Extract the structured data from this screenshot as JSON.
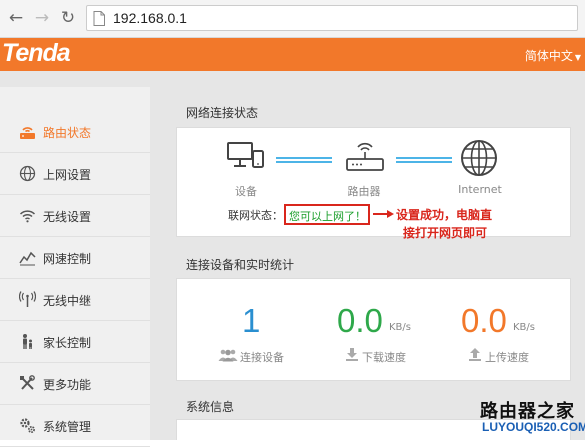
{
  "browser": {
    "url": "192.168.0.1"
  },
  "header": {
    "logo": "Tenda",
    "language": "简体中文",
    "brand_color": "#f2782a"
  },
  "sidebar": {
    "items": [
      {
        "label": "路由状态",
        "icon": "router-icon",
        "active": true
      },
      {
        "label": "上网设置",
        "icon": "globe-icon",
        "active": false
      },
      {
        "label": "无线设置",
        "icon": "wifi-icon",
        "active": false
      },
      {
        "label": "网速控制",
        "icon": "speed-chart-icon",
        "active": false
      },
      {
        "label": "无线中继",
        "icon": "antenna-icon",
        "active": false
      },
      {
        "label": "家长控制",
        "icon": "parent-child-icon",
        "active": false
      },
      {
        "label": "更多功能",
        "icon": "tools-icon",
        "active": false
      },
      {
        "label": "系统管理",
        "icon": "gears-icon",
        "active": false
      }
    ]
  },
  "network_status": {
    "title": "网络连接状态",
    "device_label": "设备",
    "router_label": "路由器",
    "internet_label": "Internet",
    "status_prefix": "联网状态：",
    "status_text": "您可以上网了！",
    "status_color": "#1a9e2a"
  },
  "annotation": {
    "line1": "设置成功，电脑直",
    "line2": "接打开网页即可",
    "color": "#d9261c"
  },
  "stats": {
    "title": "连接设备和实时统计",
    "devices": {
      "value": "1",
      "label": "连接设备",
      "color": "#2a8fd0"
    },
    "download": {
      "value": "0.0",
      "unit": "KB/s",
      "label": "下载速度",
      "color": "#2ea84a"
    },
    "upload": {
      "value": "0.0",
      "unit": "KB/s",
      "label": "上传速度",
      "color": "#f2782a"
    }
  },
  "system": {
    "title": "系统信息"
  },
  "watermark": {
    "title": "路由器之家",
    "url": "LUYOUQI520.COM"
  }
}
